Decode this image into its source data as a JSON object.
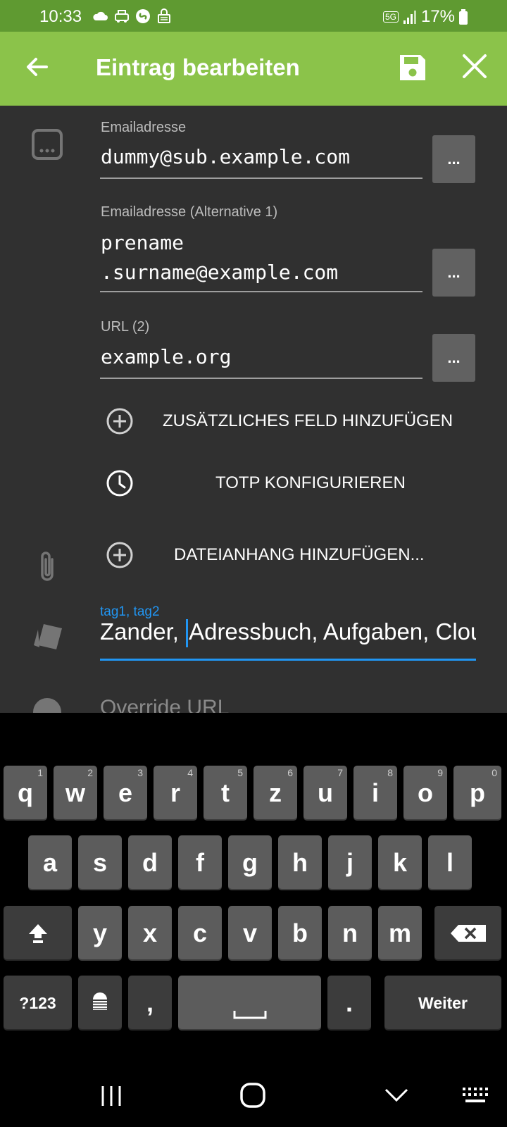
{
  "status": {
    "time": "10:33",
    "network": "5G",
    "battery": "17%"
  },
  "appbar": {
    "title": "Eintrag bearbeiten"
  },
  "fields": [
    {
      "label": "Emailadresse",
      "value": "dummy@sub.example.com"
    },
    {
      "label": "Emailadresse (Alternative 1)",
      "value_line1": "prename",
      "value_line2": ".surname@example.com"
    },
    {
      "label": "URL (2)",
      "value": "example.org"
    }
  ],
  "dots_label": "...",
  "actions": {
    "add_field": "ZUSÄTZLICHES FELD HINZUFÜGEN",
    "totp": "TOTP KONFIGURIEREN",
    "attachment": "DATEIANHANG HINZUFÜGEN..."
  },
  "tags": {
    "hint": "tag1, tag2",
    "before_cursor": "Zander, ",
    "after_cursor": "Adressbuch, Aufgaben, Clou"
  },
  "override": {
    "label": "Override URL"
  },
  "keyboard": {
    "row1": [
      "q",
      "w",
      "e",
      "r",
      "t",
      "z",
      "u",
      "i",
      "o",
      "p"
    ],
    "row1_nums": [
      "1",
      "2",
      "3",
      "4",
      "5",
      "6",
      "7",
      "8",
      "9",
      "0"
    ],
    "row2": [
      "a",
      "s",
      "d",
      "f",
      "g",
      "h",
      "j",
      "k",
      "l"
    ],
    "row3": [
      "y",
      "x",
      "c",
      "v",
      "b",
      "n",
      "m"
    ],
    "symbols": "?123",
    "comma": ",",
    "period": ".",
    "enter": "Weiter"
  }
}
